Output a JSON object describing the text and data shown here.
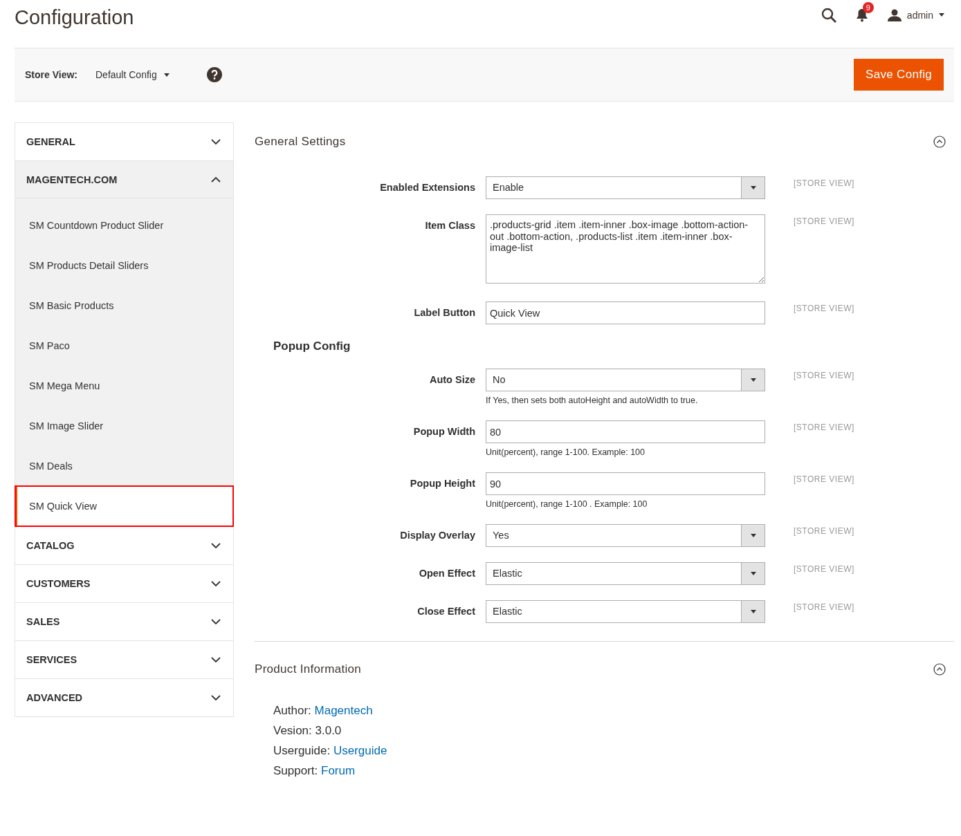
{
  "page_title": "Configuration",
  "header": {
    "notification_count": "9",
    "user": "admin"
  },
  "store_view": {
    "label": "Store View:",
    "value": "Default Config"
  },
  "save_button": "Save Config",
  "sidebar": [
    {
      "label": "GENERAL",
      "expanded": false
    },
    {
      "label": "MAGENTECH.COM",
      "expanded": true,
      "children": [
        {
          "label": "SM Countdown Product Slider",
          "selected": false,
          "highlighted": false
        },
        {
          "label": "SM Products Detail Sliders",
          "selected": false,
          "highlighted": false
        },
        {
          "label": "SM Basic Products",
          "selected": false,
          "highlighted": false
        },
        {
          "label": "SM Paco",
          "selected": false,
          "highlighted": false
        },
        {
          "label": "SM Mega Menu",
          "selected": false,
          "highlighted": false
        },
        {
          "label": "SM Image Slider",
          "selected": false,
          "highlighted": false
        },
        {
          "label": "SM Deals",
          "selected": false,
          "highlighted": false
        },
        {
          "label": "SM Quick View",
          "selected": true,
          "highlighted": true
        }
      ]
    },
    {
      "label": "CATALOG",
      "expanded": false
    },
    {
      "label": "CUSTOMERS",
      "expanded": false
    },
    {
      "label": "SALES",
      "expanded": false
    },
    {
      "label": "SERVICES",
      "expanded": false
    },
    {
      "label": "ADVANCED",
      "expanded": false
    }
  ],
  "general_settings": {
    "title": "General Settings",
    "expanded": true,
    "groups": [
      {
        "fields": [
          {
            "label": "Enabled Extensions",
            "kind": "select",
            "value": "Enable",
            "scope": "[STORE VIEW]"
          },
          {
            "label": "Item Class",
            "kind": "textarea",
            "value": ".products-grid .item .item-inner .box-image .bottom-action-out .bottom-action, .products-list .item .item-inner .box-image-list",
            "scope": "[STORE VIEW]"
          },
          {
            "label": "Label Button",
            "kind": "text",
            "value": "Quick View",
            "scope": "[STORE VIEW]"
          }
        ]
      },
      {
        "title": "Popup Config",
        "fields": [
          {
            "label": "Auto Size",
            "kind": "select",
            "value": "No",
            "hint": "If Yes, then sets both autoHeight and autoWidth to true.",
            "scope": "[STORE VIEW]"
          },
          {
            "label": "Popup Width",
            "kind": "text",
            "value": "80",
            "hint": "Unit(percent), range 1-100. Example: 100",
            "scope": "[STORE VIEW]"
          },
          {
            "label": "Popup Height",
            "kind": "text",
            "value": "90",
            "hint": "Unit(percent), range 1-100 . Example: 100",
            "scope": "[STORE VIEW]"
          },
          {
            "label": "Display Overlay",
            "kind": "select",
            "value": "Yes",
            "scope": "[STORE VIEW]"
          },
          {
            "label": "Open Effect",
            "kind": "select",
            "value": "Elastic",
            "scope": "[STORE VIEW]"
          },
          {
            "label": "Close Effect",
            "kind": "select",
            "value": "Elastic",
            "scope": "[STORE VIEW]"
          }
        ]
      }
    ]
  },
  "product_information": {
    "title": "Product Information",
    "expanded": true,
    "lines": [
      {
        "label": "Author:",
        "kind": "link",
        "value": "Magentech"
      },
      {
        "label": "Vesion:",
        "kind": "text",
        "value": "3.0.0"
      },
      {
        "label": "Userguide:",
        "kind": "link",
        "value": "Userguide"
      },
      {
        "label": "Support:",
        "kind": "link",
        "value": "Forum"
      }
    ]
  }
}
